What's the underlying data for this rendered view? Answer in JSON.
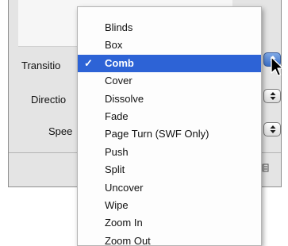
{
  "dialog": {
    "transition_label": "Transitio",
    "direction_label": "Directio",
    "speed_label": "Spee"
  },
  "menu": {
    "check_mark": "✓",
    "selected_value": "Comb",
    "items": [
      {
        "label": "Blinds"
      },
      {
        "label": "Box"
      },
      {
        "label": "Comb",
        "selected": true
      },
      {
        "label": "Cover"
      },
      {
        "label": "Dissolve"
      },
      {
        "label": "Fade"
      },
      {
        "label": "Page Turn (SWF Only)"
      },
      {
        "label": "Push"
      },
      {
        "label": "Split"
      },
      {
        "label": "Uncover"
      },
      {
        "label": "Wipe"
      },
      {
        "label": "Zoom In"
      },
      {
        "label": "Zoom Out"
      }
    ]
  },
  "colors": {
    "selection": "#2d63d6",
    "panel": "#e4e4e4"
  },
  "icons": {
    "popup_arrows": "up-down-arrows-icon",
    "cursor": "mouse-pointer-icon",
    "corner": "resize-icon"
  }
}
